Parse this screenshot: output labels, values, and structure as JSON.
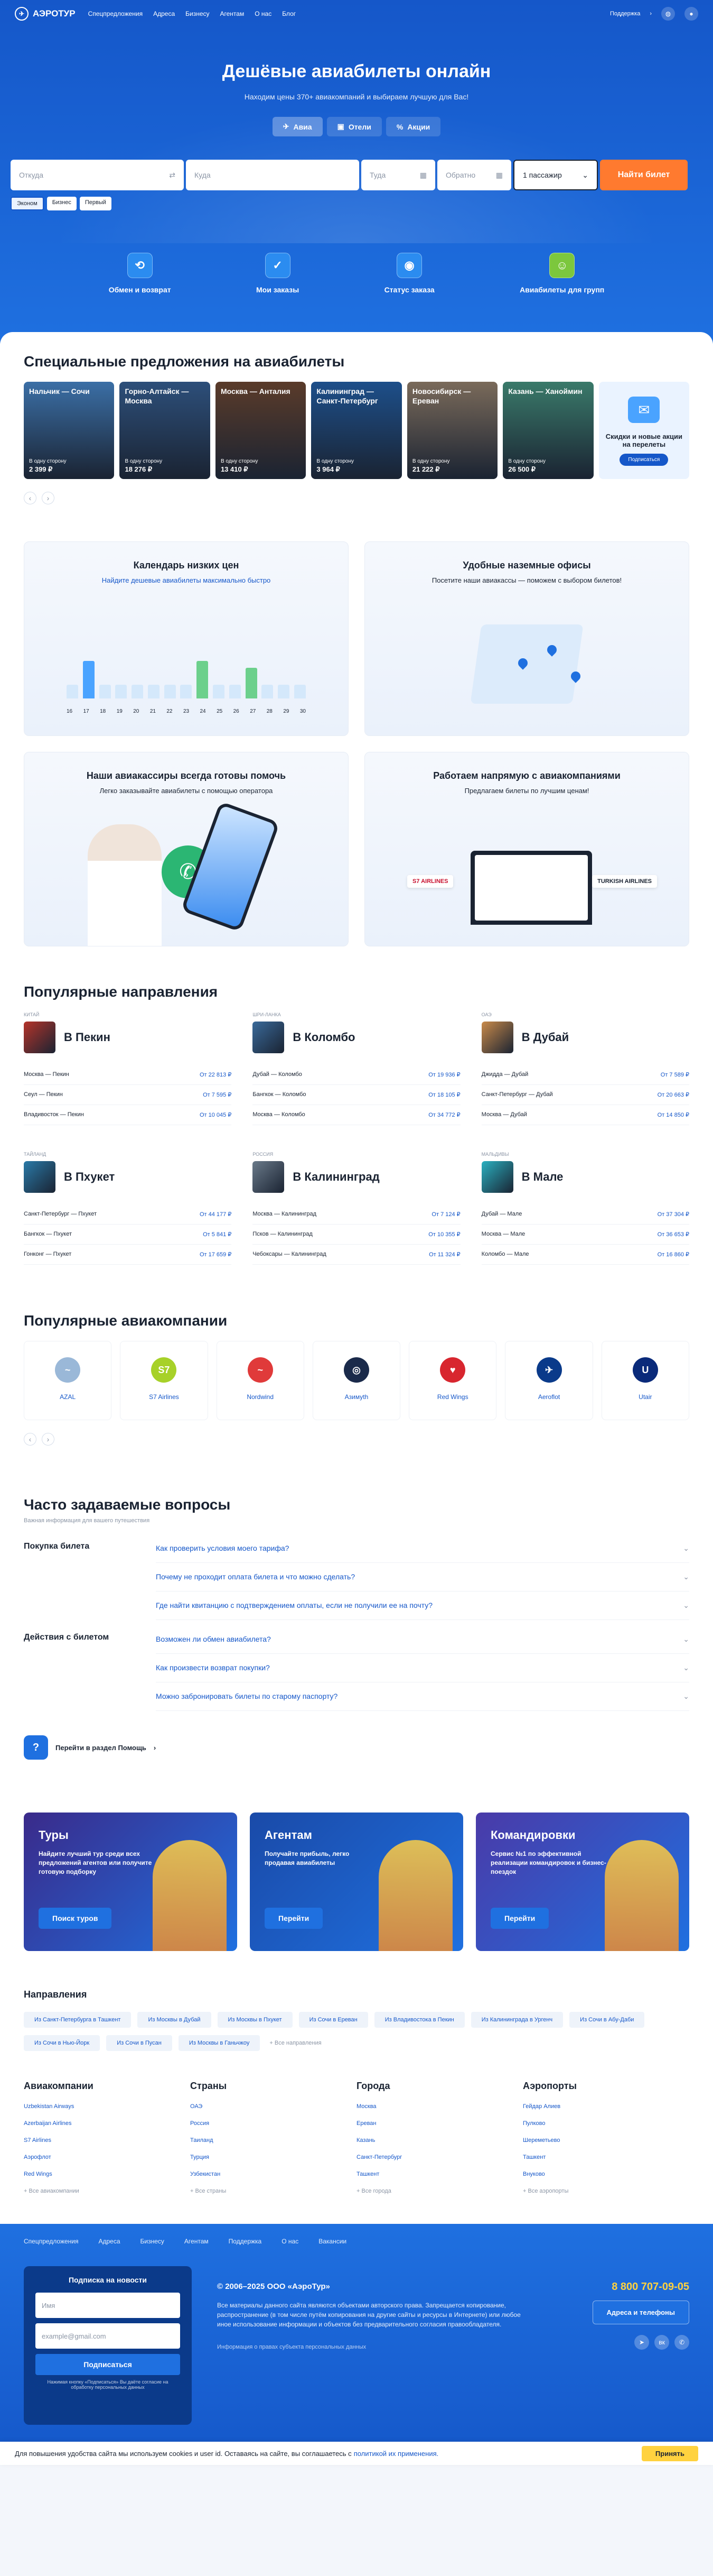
{
  "header": {
    "logo": "АЭРОТУР",
    "nav": [
      "Спецпредложения",
      "Адреса",
      "Бизнесу",
      "Агентам",
      "О нас",
      "Блог"
    ],
    "support": "Поддержка"
  },
  "hero": {
    "title": "Дешёвые авиабилеты онлайн",
    "subtitle": "Находим цены 370+ авиакомпаний и выбираем лучшую для Вас!",
    "tabs": [
      {
        "label": "Авиа",
        "icon": "✈"
      },
      {
        "label": "Отели",
        "icon": "▣"
      },
      {
        "label": "Акции",
        "icon": "%"
      }
    ]
  },
  "search": {
    "from": "Откуда",
    "to": "Куда",
    "date_there": "Туда",
    "date_back": "Обратно",
    "passengers": "1 пассажир",
    "button": "Найти билет",
    "classes": [
      "Эконом",
      "Бизнес",
      "Первый"
    ]
  },
  "quick": [
    "Обмен и возврат",
    "Мои заказы",
    "Статус заказа",
    "Авиабилеты для групп"
  ],
  "offers": {
    "title": "Специальные предложения на авиабилеты",
    "items": [
      {
        "title": "Нальчик — Сочи",
        "note": "В одну сторону",
        "price": "2 399 ₽",
        "color": "#3b6fa6"
      },
      {
        "title": "Горно-Алтайск — Москва",
        "note": "В одну сторону",
        "price": "18 276 ₽",
        "color": "#2d4f7a"
      },
      {
        "title": "Москва — Анталия",
        "note": "В одну сторону",
        "price": "13 410 ₽",
        "color": "#5a3b2a"
      },
      {
        "title": "Калининград — Санкт-Петербург",
        "note": "В одну сторону",
        "price": "3 964 ₽",
        "color": "#1d4f8a"
      },
      {
        "title": "Новосибирск — Ереван",
        "note": "В одну сторону",
        "price": "21 222 ₽",
        "color": "#7a6a5a"
      },
      {
        "title": "Казань — Ханоймин",
        "note": "В одну сторону",
        "price": "26 500 ₽",
        "color": "#3a7a6a"
      }
    ],
    "promo": {
      "text": "Скидки и новые акции на перелеты",
      "button": "Подписаться"
    }
  },
  "features": [
    {
      "title": "Календарь низких цен",
      "sub": "Найдите дешевые авиабилеты максимально быстро",
      "days": [
        "16",
        "17",
        "18",
        "19",
        "20",
        "21",
        "22",
        "23",
        "24",
        "25",
        "26",
        "27",
        "28",
        "29",
        "30"
      ],
      "bars": [
        0.2,
        0.55,
        0.2,
        0.2,
        0.2,
        0.2,
        0.2,
        0.2,
        0.55,
        0.2,
        0.2,
        0.45,
        0.2,
        0.2,
        0.2
      ]
    },
    {
      "title": "Удобные наземные офисы",
      "sub": "Посетите наши авиакассы — поможем с выбором билетов!"
    },
    {
      "title": "Наши авиакассиры всегда готовы помочь",
      "sub": "Легко заказывайте авиабилеты с помощью оператора"
    },
    {
      "title": "Работаем напрямую с авиакомпаниями",
      "sub": "Предлагаем билеты по лучшим ценам!",
      "logos": [
        "S7 AIRLINES",
        "TURKISH AIRLINES"
      ]
    }
  ],
  "destinations": {
    "title": "Популярные направления",
    "items": [
      {
        "country": "КИТАЙ",
        "city": "В Пекин",
        "color": "#b5342a",
        "routes": [
          [
            "Москва — Пекин",
            "От 22 813 ₽"
          ],
          [
            "Сеул — Пекин",
            "От 7 595 ₽"
          ],
          [
            "Владивосток — Пекин",
            "От 10 045 ₽"
          ]
        ]
      },
      {
        "country": "ШРИ-ЛАНКА",
        "city": "В Коломбо",
        "color": "#3a6a9a",
        "routes": [
          [
            "Дубай — Коломбо",
            "От 19 936 ₽"
          ],
          [
            "Бангкок — Коломбо",
            "От 18 105 ₽"
          ],
          [
            "Москва — Коломбо",
            "От 34 772 ₽"
          ]
        ]
      },
      {
        "country": "ОАЭ",
        "city": "В Дубай",
        "color": "#c98a4a",
        "routes": [
          [
            "Джидда — Дубай",
            "От 7 589 ₽"
          ],
          [
            "Санкт-Петербург — Дубай",
            "От 20 663 ₽"
          ],
          [
            "Москва — Дубай",
            "От 14 850 ₽"
          ]
        ]
      },
      {
        "country": "ТАЙЛАНД",
        "city": "В Пхукет",
        "color": "#2a7aa8",
        "routes": [
          [
            "Санкт-Петербург — Пхукет",
            "От 44 177 ₽"
          ],
          [
            "Бангкок — Пхукет",
            "От 5 841 ₽"
          ],
          [
            "Гонконг — Пхукет",
            "От 17 659 ₽"
          ]
        ]
      },
      {
        "country": "РОССИЯ",
        "city": "В Калининград",
        "color": "#6a7a8a",
        "routes": [
          [
            "Москва — Калининград",
            "От 7 124 ₽"
          ],
          [
            "Псков — Калининград",
            "От 10 355 ₽"
          ],
          [
            "Чебоксары — Калининград",
            "От 11 324 ₽"
          ]
        ]
      },
      {
        "country": "МАЛЬДИВЫ",
        "city": "В Мале",
        "color": "#2ab0c0",
        "routes": [
          [
            "Дубай — Мале",
            "От 37 304 ₽"
          ],
          [
            "Москва — Мале",
            "От 36 653 ₽"
          ],
          [
            "Коломбо — Мале",
            "От 16 860 ₽"
          ]
        ]
      }
    ]
  },
  "airlines": {
    "title": "Популярные авиакомпании",
    "items": [
      {
        "name": "AZAL",
        "mark": "~",
        "color": "#9ab8d8"
      },
      {
        "name": "S7 Airlines",
        "mark": "S7",
        "color": "#a7d129"
      },
      {
        "name": "Nordwind",
        "mark": "~",
        "color": "#e03a3a"
      },
      {
        "name": "Азимуth",
        "mark": "◎",
        "color": "#1a2a4a"
      },
      {
        "name": "Red Wings",
        "mark": "♥",
        "color": "#d8262f"
      },
      {
        "name": "Aeroflot",
        "mark": "✈",
        "color": "#0a3a8a"
      },
      {
        "name": "Utair",
        "mark": "U",
        "color": "#0a2a7a"
      }
    ]
  },
  "faq": {
    "title": "Часто задаваемые вопросы",
    "sub": "Важная информация для вашего путешествия",
    "groups": [
      {
        "name": "Покупка билета",
        "questions": [
          "Как проверить условия моего тарифа?",
          "Почему не проходит оплата билета и что можно сделать?",
          "Где найти квитанцию с подтверждением оплаты, если не получили ее на почту?"
        ]
      },
      {
        "name": "Действия с билетом",
        "questions": [
          "Возможен ли обмен авиабилета?",
          "Как произвести возврат покупки?",
          "Можно забронировать билеты по старому паспорту?"
        ]
      }
    ],
    "help": "Перейти в раздел Помощь"
  },
  "cards": [
    {
      "title": "Туры",
      "text": "Найдите лучший тур среди всех предложений агентов или получите готовую подборку",
      "button": "Поиск туров",
      "bg": "#3a2a8a"
    },
    {
      "title": "Агентам",
      "text": "Получайте прибыль, легко продавая авиабилеты",
      "button": "Перейти",
      "bg": "#1a4aa8"
    },
    {
      "title": "Командировки",
      "text": "Сервис №1 по эффективной реализации командировок и бизнес-поездок",
      "button": "Перейти",
      "bg": "#4a3aa8"
    }
  ],
  "directions": {
    "title": "Направления",
    "items": [
      "Из Санкт-Петербурга в Ташкент",
      "Из Москвы в Дубай",
      "Из Москвы в Пхукет",
      "Из Сочи в Ереван",
      "Из Владивостока в Пекин",
      "Из Калининграда в Ургенч",
      "Из Сочи в Абу-Даби",
      "Из Сочи в Нью-Йорк",
      "Из Сочи в Пусан",
      "Из Москвы в Ганьчжоу"
    ],
    "more": "+ Все направления"
  },
  "columns": [
    {
      "title": "Авиакомпании",
      "links": [
        "Uzbekistan Airways",
        "Azerbaijan Airlines",
        "S7 Airlines",
        "Аэрофлот",
        "Red Wings"
      ],
      "more": "+ Все авиакомпании"
    },
    {
      "title": "Страны",
      "links": [
        "ОАЭ",
        "Россия",
        "Таиланд",
        "Турция",
        "Узбекистан"
      ],
      "more": "+ Все страны"
    },
    {
      "title": "Города",
      "links": [
        "Москва",
        "Ереван",
        "Казань",
        "Санкт-Петербург",
        "Ташкент"
      ],
      "more": "+ Все города"
    },
    {
      "title": "Аэропорты",
      "links": [
        "Гейдар Алиев",
        "Пулково",
        "Шереметьево",
        "Ташкент",
        "Внуково"
      ],
      "more": "+ Все аэропорты"
    }
  ],
  "footer": {
    "nav": [
      "Спецпредложения",
      "Адреса",
      "Бизнесу",
      "Агентам",
      "Поддержка",
      "О нас",
      "Вакансии"
    ],
    "subscribe": {
      "title": "Подписка на новости",
      "name": "Имя",
      "email": "example@gmail.com",
      "button": "Подписаться",
      "note": "Нажимая кнопку «Подписаться» Вы даёте согласие на обработку персональных данных"
    },
    "copyright": "© 2006–2025 ООО «АэроТур»",
    "legal": "Все материалы данного сайта являются объектами авторского права. Запрещается копирование, распространение (в том числе путём копирования на другие сайты и ресурсы в Интернете) или любое иное использование информации и объектов без предварительного согласия правообладателя.",
    "info": "Информация о правах субъекта персональных данных",
    "phone": "8 800 707-09-05",
    "addr": "Адреса и телефоны"
  },
  "cookie": {
    "text": "Для повышения удобства сайта мы используем cookies и user id. Оставаясь на сайте, вы соглашаетесь с",
    "link": "политикой их применения.",
    "button": "Принять"
  }
}
